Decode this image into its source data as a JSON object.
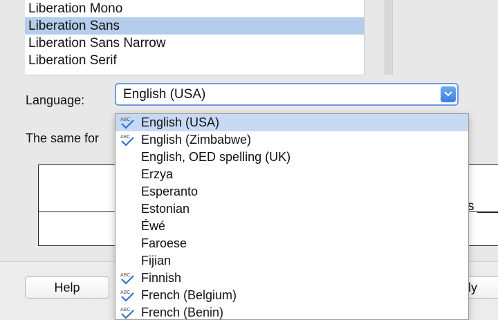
{
  "font_list": {
    "items": [
      {
        "label": "Liberation Mono",
        "selected": false
      },
      {
        "label": "Liberation Sans",
        "selected": true
      },
      {
        "label": "Liberation Sans Narrow",
        "selected": false
      },
      {
        "label": "Liberation Serif",
        "selected": false
      }
    ]
  },
  "language": {
    "label": "Language:",
    "value": "English (USA)",
    "options": [
      {
        "label": "English (USA)",
        "spellcheck": true,
        "highlighted": true
      },
      {
        "label": "English (Zimbabwe)",
        "spellcheck": true,
        "highlighted": false
      },
      {
        "label": "English, OED spelling (UK)",
        "spellcheck": false,
        "highlighted": false
      },
      {
        "label": "Erzya",
        "spellcheck": false,
        "highlighted": false
      },
      {
        "label": "Esperanto",
        "spellcheck": false,
        "highlighted": false
      },
      {
        "label": "Estonian",
        "spellcheck": false,
        "highlighted": false
      },
      {
        "label": "Éwé",
        "spellcheck": false,
        "highlighted": false
      },
      {
        "label": "Faroese",
        "spellcheck": false,
        "highlighted": false
      },
      {
        "label": "Fijian",
        "spellcheck": false,
        "highlighted": false
      },
      {
        "label": "Finnish",
        "spellcheck": true,
        "highlighted": false
      },
      {
        "label": "French (Belgium)",
        "spellcheck": true,
        "highlighted": false
      },
      {
        "label": "French (Benin)",
        "spellcheck": true,
        "highlighted": false
      }
    ]
  },
  "same_for_label": "The same for",
  "preview_text": "s",
  "buttons": {
    "help": "Help",
    "apply": "pply"
  },
  "colors": {
    "selection": "#b4cdec",
    "highlight": "#c7daf3",
    "accent": "#3c7ee0"
  }
}
